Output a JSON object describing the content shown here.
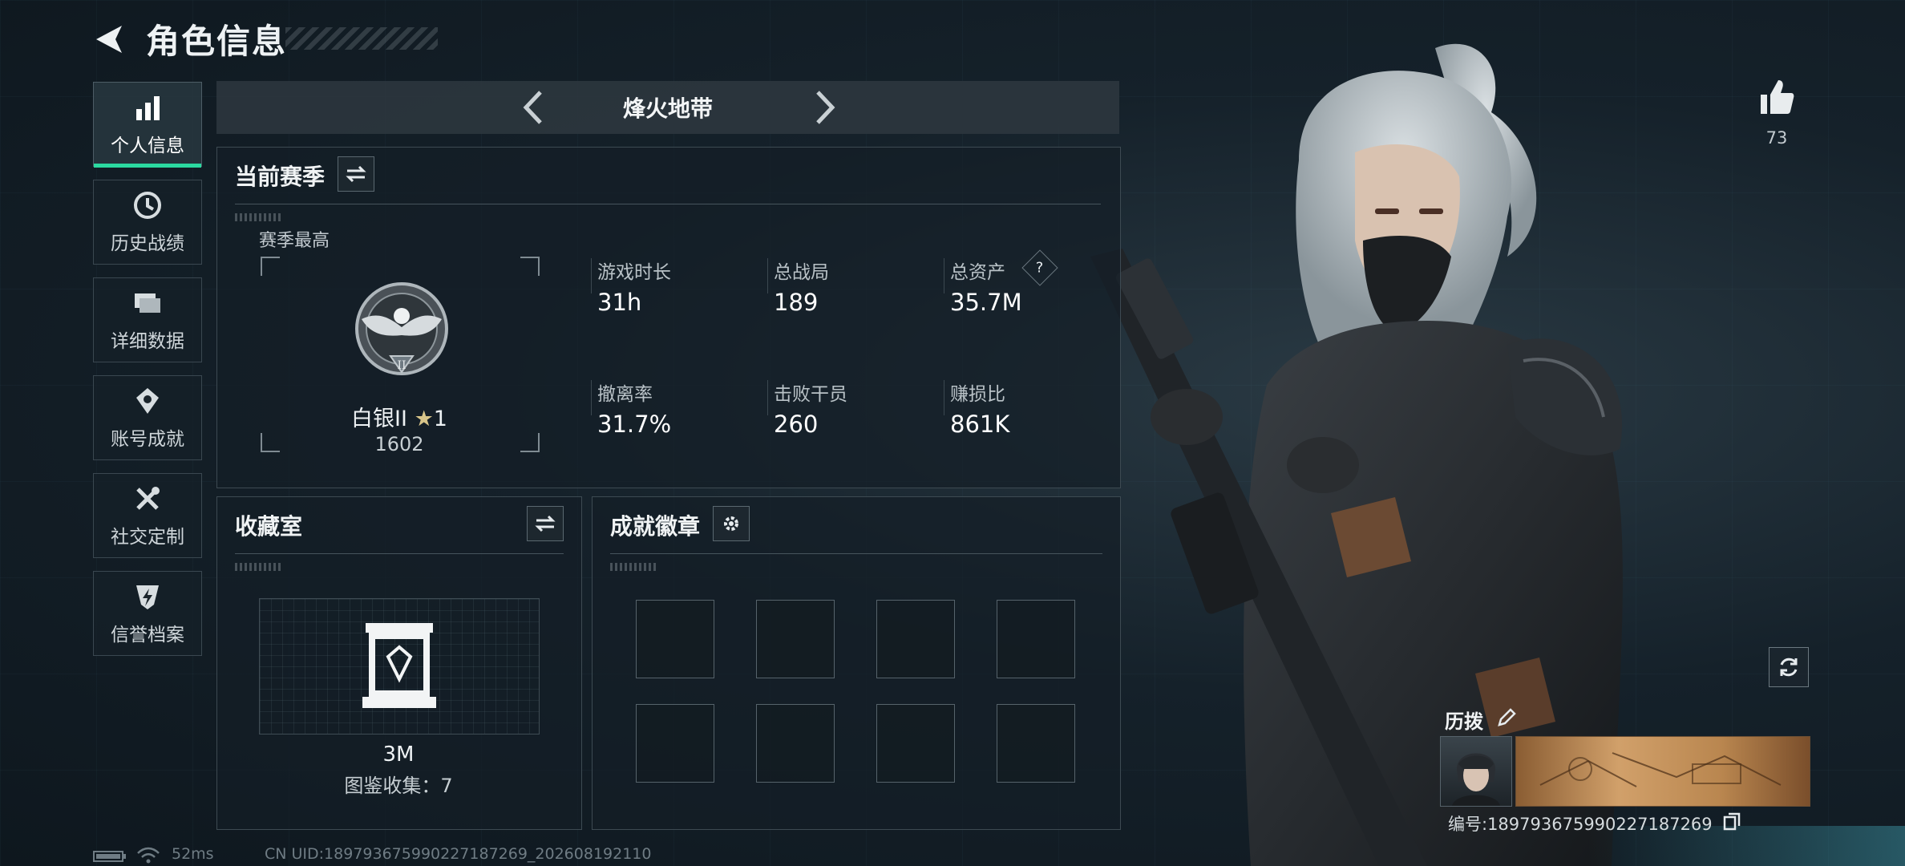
{
  "header": {
    "title": "角色信息"
  },
  "sidebar": {
    "items": [
      {
        "label": "个人信息",
        "icon": "bar-chart-icon",
        "active": true
      },
      {
        "label": "历史战绩",
        "icon": "clock-icon"
      },
      {
        "label": "详细数据",
        "icon": "folder-icon"
      },
      {
        "label": "账号成就",
        "icon": "achievement-icon"
      },
      {
        "label": "社交定制",
        "icon": "tools-icon"
      },
      {
        "label": "信誉档案",
        "icon": "shield-bolt-icon"
      }
    ]
  },
  "mode_bar": {
    "title": "烽火地带"
  },
  "season": {
    "title": "当前赛季",
    "best_label": "赛季最高",
    "rank_name": "白银II",
    "rank_stars": "1",
    "rank_score": "1602",
    "stats": [
      {
        "label": "游戏时长",
        "value": "31h"
      },
      {
        "label": "总战局",
        "value": "189"
      },
      {
        "label": "总资产",
        "value": "35.7M"
      },
      {
        "label": "撤离率",
        "value": "31.7%"
      },
      {
        "label": "击败干员",
        "value": "260"
      },
      {
        "label": "赚损比",
        "value": "861K"
      }
    ],
    "help_icon_text": "?"
  },
  "collection": {
    "title": "收藏室",
    "value": "3M",
    "count_text": "图鉴收集：7"
  },
  "achievements": {
    "title": "成就徽章",
    "slots": 8
  },
  "profile": {
    "likes": "73",
    "nickname": "历拨",
    "id_text": "编号:189793675990227187269"
  },
  "status_bar": {
    "ping": "52ms",
    "uid": "CN UID:189793675990227187269_202608192110"
  },
  "colors": {
    "accent": "#2bd9a0",
    "panel_border": "#3d4a52"
  }
}
